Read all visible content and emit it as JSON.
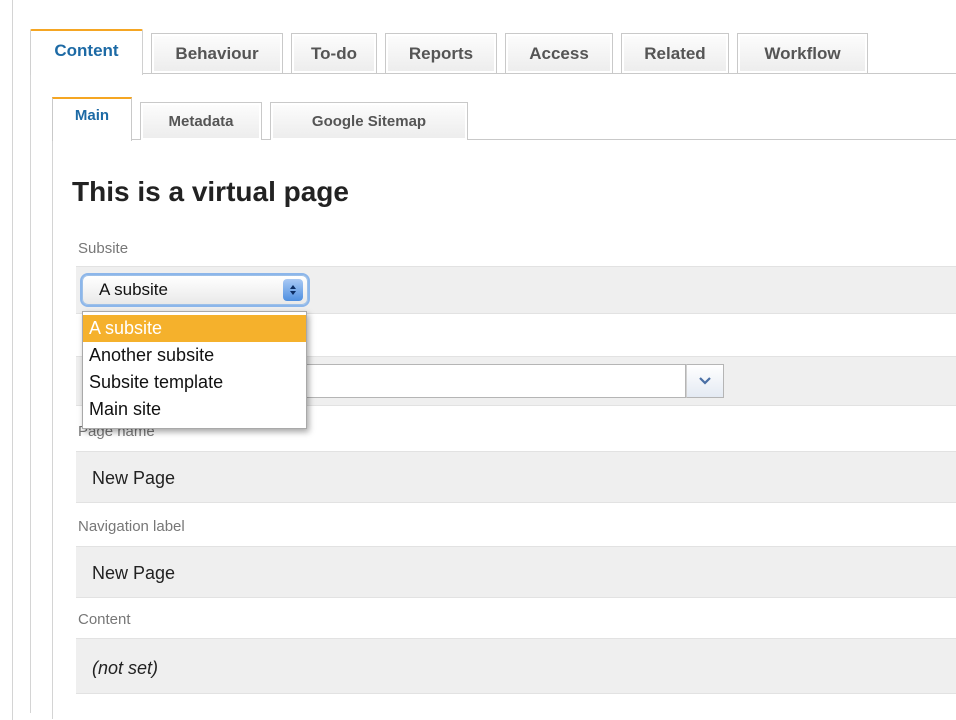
{
  "top_tabs": [
    {
      "label": "Content",
      "active": true
    },
    {
      "label": "Behaviour",
      "active": false
    },
    {
      "label": "To-do",
      "active": false
    },
    {
      "label": "Reports",
      "active": false
    },
    {
      "label": "Access",
      "active": false
    },
    {
      "label": "Related",
      "active": false
    },
    {
      "label": "Workflow",
      "active": false
    }
  ],
  "sub_tabs": [
    {
      "label": "Main",
      "active": true
    },
    {
      "label": "Metadata",
      "active": false
    },
    {
      "label": "Google Sitemap",
      "active": false
    }
  ],
  "page_title": "This is a virtual page",
  "subsite": {
    "label": "Subsite",
    "selected": "A subsite",
    "options": [
      "A subsite",
      "Another subsite",
      "Subsite template",
      "Main site"
    ]
  },
  "page_name": {
    "label": "Page name",
    "value": "New Page"
  },
  "navigation_label": {
    "label": "Navigation label",
    "value": "New Page"
  },
  "content": {
    "label": "Content",
    "value": "(not set)"
  },
  "colors": {
    "active_tab_accent": "#f5a623",
    "active_tab_text": "#1d6aa5",
    "selected_option_bg": "#f5b12c"
  }
}
